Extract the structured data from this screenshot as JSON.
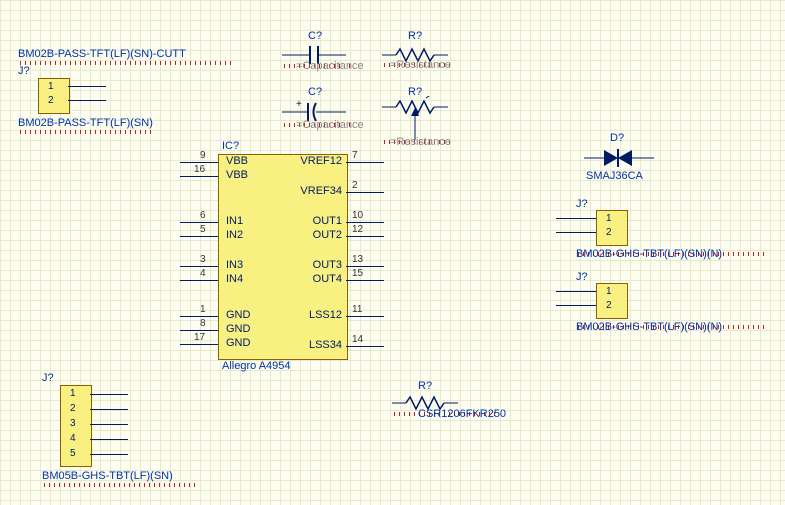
{
  "headers": {
    "top_label": "BM02B-PASS-TFT(LF)(SN)-CUTT",
    "conn1_ref": "J?",
    "conn1_type": "BM02B-PASS-TFT(LF)(SN)",
    "conn2_ref": "J?",
    "conn2_type": "BM05B-GHS-TBT(LF)(SN)",
    "conn3_ref": "J?",
    "conn3_type": "BM02B-GHS-TBT(LF)(SN)(N)",
    "conn4_ref": "J?",
    "conn4_type": "BM02B-GHS-TBT(LF)(SN)(N)"
  },
  "cap1": {
    "ref": "C?",
    "val": "=Capacitance"
  },
  "cap2": {
    "ref": "C?",
    "val": "=Capacitance"
  },
  "res1": {
    "ref": "R?",
    "val": "=Resistance"
  },
  "res2": {
    "ref": "R?",
    "val": "=Resistance"
  },
  "res3": {
    "ref": "R?",
    "val": "CSR1206FKR250"
  },
  "diode": {
    "ref": "D?",
    "val": "SMAJ36CA"
  },
  "ic": {
    "ref": "IC?",
    "val": "Allegro A4954",
    "left_pins": [
      {
        "num": "9",
        "name": "VBB"
      },
      {
        "num": "16",
        "name": "VBB"
      },
      {
        "num": "6",
        "name": "IN1"
      },
      {
        "num": "5",
        "name": "IN2"
      },
      {
        "num": "3",
        "name": "IN3"
      },
      {
        "num": "4",
        "name": "IN4"
      },
      {
        "num": "1",
        "name": "GND"
      },
      {
        "num": "8",
        "name": "GND"
      },
      {
        "num": "17",
        "name": "GND"
      }
    ],
    "right_pins": [
      {
        "num": "7",
        "name": "VREF12"
      },
      {
        "num": "2",
        "name": "VREF34"
      },
      {
        "num": "10",
        "name": "OUT1"
      },
      {
        "num": "12",
        "name": "OUT2"
      },
      {
        "num": "13",
        "name": "OUT3"
      },
      {
        "num": "15",
        "name": "OUT4"
      },
      {
        "num": "11",
        "name": "LSS12"
      },
      {
        "num": "14",
        "name": "LSS34"
      }
    ]
  },
  "conn1_pins": [
    "1",
    "2"
  ],
  "conn2_pins": [
    "1",
    "2",
    "3",
    "4",
    "5"
  ],
  "conn3_pins": [
    "1",
    "2"
  ],
  "conn4_pins": [
    "1",
    "2"
  ]
}
